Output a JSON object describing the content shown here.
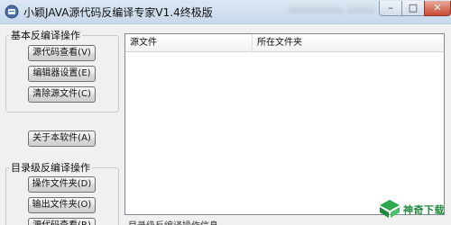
{
  "window": {
    "title": "小颖JAVA源代码反编译专家V1.4终极版",
    "controls": {
      "minimize": "–",
      "maximize": "□",
      "close": "✕"
    }
  },
  "basic_group": {
    "label": "基本反编译操作",
    "buttons": [
      "源代码查看(V)",
      "编辑器设置(E)",
      "清除源文件(C)"
    ]
  },
  "about_button": "关于本软件(A)",
  "dir_group": {
    "label": "目录级反编译操作",
    "buttons": [
      "操作文件夹(D)",
      "输出文件夹(O)",
      "源代码查看(R)"
    ]
  },
  "file_table": {
    "columns": [
      "源文件",
      "所在文件夹"
    ],
    "rows": []
  },
  "bottom_status": "目录级反编译操作信息",
  "watermark": {
    "text": "神奇下载",
    "color": "#1f8a3c"
  },
  "colors": {
    "accent": "#3366cc",
    "close": "#c94a33"
  }
}
